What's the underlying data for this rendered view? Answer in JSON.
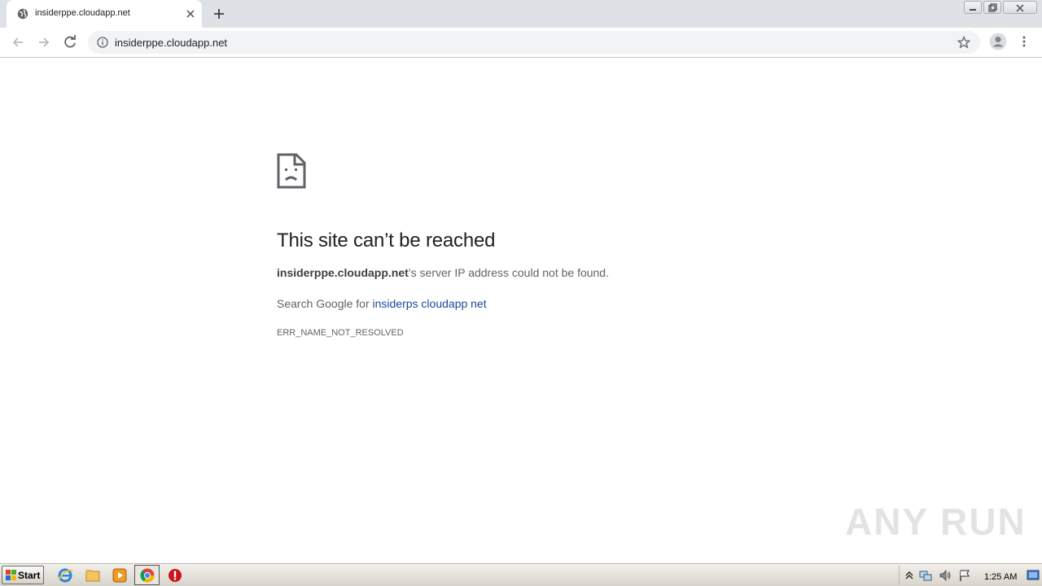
{
  "browser": {
    "tab": {
      "title": "insiderppe.cloudapp.net",
      "favicon": "globe-icon"
    },
    "new_tab_icon": "plus-icon",
    "address_bar": {
      "url": "insiderppe.cloudapp.net",
      "info_icon": "info-icon"
    },
    "toolbar_icons": [
      "back-icon",
      "forward-icon",
      "reload-icon",
      "star-icon",
      "profile-icon",
      "menu-icon"
    ],
    "window_controls": [
      "minimize-icon",
      "restore-icon",
      "close-icon"
    ]
  },
  "error": {
    "icon": "sad-page-icon",
    "title": "This site can’t be reached",
    "host": "insiderppe.cloudapp.net",
    "message_suffix": "’s server IP address could not be found.",
    "search_prefix": "Search Google for ",
    "search_link": "insiderps cloudapp net",
    "code": "ERR_NAME_NOT_RESOLVED"
  },
  "watermark": {
    "text": "ANY RUN"
  },
  "taskbar": {
    "start_label": "Start",
    "pinned": [
      "ie-icon",
      "explorer-icon",
      "media-player-icon",
      "chrome-icon",
      "stop-icon"
    ],
    "tray_icons": [
      "tray-arrow-icon",
      "network-icon",
      "volume-icon",
      "flag-icon",
      "show-desktop-icon"
    ],
    "clock": "1:25 AM"
  },
  "colors": {
    "tabstrip": "#dee1e6",
    "omnibox": "#f1f3f4",
    "link": "#1a4a9a",
    "title_text": "#202124",
    "body_text": "#5f6368"
  }
}
